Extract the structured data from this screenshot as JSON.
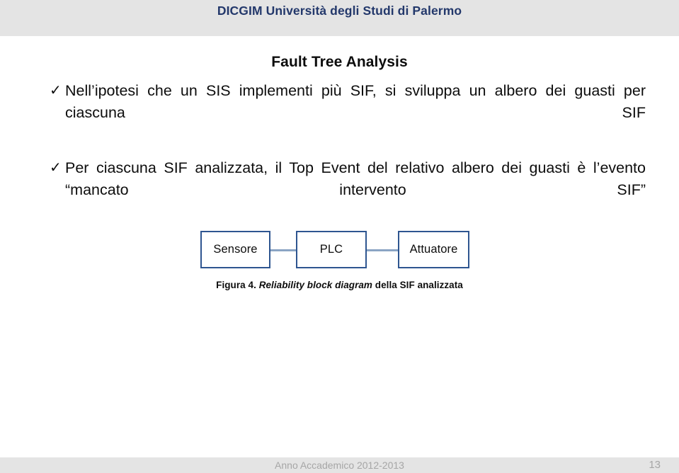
{
  "header": {
    "institution": "DICGIM Università degli Studi di Palermo",
    "band_color": "#e4e4e4",
    "text_color": "#23386b"
  },
  "slide": {
    "title": "Fault Tree Analysis",
    "bullets": [
      {
        "marker": "✓",
        "text": "Nell’ipotesi che un SIS implementi più SIF, si sviluppa un albero dei guasti per ciascuna SIF"
      },
      {
        "marker": "✓",
        "text": "Per ciascuna SIF analizzata, il Top Event del relativo albero dei guasti è l’evento “mancato intervento SIF”"
      }
    ]
  },
  "diagram": {
    "type": "reliability-block-diagram",
    "border_color": "#2e5590",
    "link_color": "#8ba4c4",
    "blocks": [
      {
        "label": "Sensore"
      },
      {
        "label": "PLC"
      },
      {
        "label": "Attuatore"
      }
    ],
    "caption": {
      "prefix": "Figura 4.",
      "italic": "Reliability block diagram",
      "suffix": "della SIF analizzata"
    }
  },
  "footer": {
    "academic_year": "Anno Accademico 2012-2013",
    "page_number": "13",
    "band_color": "#e4e4e4",
    "text_color": "#a6a6a6"
  }
}
